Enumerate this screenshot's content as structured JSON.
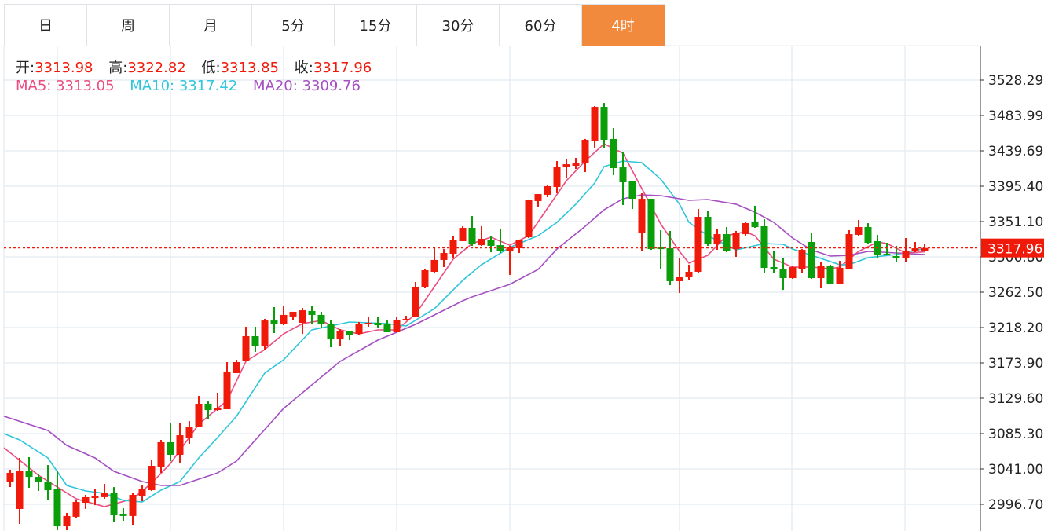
{
  "tabs": [
    {
      "label": "日",
      "active": false
    },
    {
      "label": "周",
      "active": false
    },
    {
      "label": "月",
      "active": false
    },
    {
      "label": "5分",
      "active": false
    },
    {
      "label": "15分",
      "active": false
    },
    {
      "label": "30分",
      "active": false
    },
    {
      "label": "60分",
      "active": false
    },
    {
      "label": "4时",
      "active": true
    }
  ],
  "info": {
    "open_label": "开:",
    "open": "3313.98",
    "high_label": "高:",
    "high": "3322.82",
    "low_label": "低:",
    "low": "3313.85",
    "close_label": "收:",
    "close": "3317.96",
    "ma5_label": "MA5:",
    "ma5": "3313.05",
    "ma10_label": "MA10:",
    "ma10": "3317.42",
    "ma20_label": "MA20:",
    "ma20": "3309.76"
  },
  "colors": {
    "up": "#f01a0a",
    "down": "#0a9e0a",
    "ma5": "#ec4d80",
    "ma10": "#2fc6db",
    "ma20": "#a54fc2",
    "accent": "#f28a3e"
  },
  "chart_data": {
    "type": "candlestick",
    "y_ticks": [
      "3528.29",
      "3483.99",
      "3439.69",
      "3395.40",
      "3351.10",
      "3306.80",
      "3262.50",
      "3218.20",
      "3173.90",
      "3129.60",
      "3085.30",
      "3041.00",
      "2996.70"
    ],
    "ylim": [
      2970.0,
      3528.29
    ],
    "last_price": "3317.96",
    "grid": true,
    "ohlc": [
      [
        3025.2,
        3040.0,
        3018.3,
        3036.1
      ],
      [
        2990.8,
        3054.8,
        2972.1,
        3039.0
      ],
      [
        3038.0,
        3055.8,
        3017.4,
        3031.1
      ],
      [
        3031.1,
        3035.1,
        3013.4,
        3024.3
      ],
      [
        3025.2,
        3045.9,
        3002.6,
        3014.4
      ],
      [
        3015.4,
        3038.0,
        2964.2,
        2969.1
      ],
      [
        2969.1,
        2985.9,
        2964.2,
        2982.0
      ],
      [
        2981.0,
        3002.6,
        2979.0,
        2999.6
      ],
      [
        2998.6,
        3008.5,
        2990.8,
        3005.6
      ],
      [
        3004.6,
        3015.4,
        2995.7,
        3006.5
      ],
      [
        3005.6,
        3022.3,
        3003.6,
        3010.5
      ],
      [
        3010.5,
        3018.3,
        2975.0,
        2983.9
      ],
      [
        2984.9,
        2991.8,
        2976.0,
        2982.0
      ],
      [
        2982.0,
        3010.5,
        2971.1,
        3008.5
      ],
      [
        3007.5,
        3020.3,
        3000.6,
        3015.4
      ],
      [
        3014.4,
        3051.8,
        3013.4,
        3044.9
      ],
      [
        3043.9,
        3077.4,
        3036.1,
        3074.5
      ],
      [
        3074.5,
        3099.1,
        3050.8,
        3058.7
      ],
      [
        3058.7,
        3099.1,
        3048.9,
        3083.3
      ],
      [
        3080.4,
        3101.0,
        3072.5,
        3094.1
      ],
      [
        3093.2,
        3132.5,
        3093.2,
        3122.7
      ],
      [
        3122.7,
        3126.6,
        3104.0,
        3114.8
      ],
      [
        3114.8,
        3136.5,
        3113.8,
        3116.8
      ],
      [
        3115.8,
        3174.9,
        3115.8,
        3163.1
      ],
      [
        3161.1,
        3177.8,
        3161.1,
        3174.9
      ],
      [
        3175.9,
        3219.2,
        3175.9,
        3207.4
      ],
      [
        3207.4,
        3219.2,
        3187.7,
        3195.5
      ],
      [
        3194.6,
        3229.0,
        3190.6,
        3227.0
      ],
      [
        3227.0,
        3243.8,
        3211.3,
        3223.1
      ],
      [
        3223.1,
        3245.7,
        3221.1,
        3234.0
      ],
      [
        3232.0,
        3237.9,
        3228.0,
        3237.9
      ],
      [
        3224.1,
        3242.8,
        3210.3,
        3239.8
      ],
      [
        3238.9,
        3245.7,
        3222.1,
        3234.0
      ],
      [
        3234.0,
        3237.9,
        3217.2,
        3223.1
      ],
      [
        3223.1,
        3227.0,
        3193.6,
        3203.4
      ],
      [
        3203.4,
        3216.2,
        3195.5,
        3213.3
      ],
      [
        3213.3,
        3214.3,
        3202.4,
        3209.3
      ],
      [
        3210.3,
        3225.1,
        3209.3,
        3223.1
      ],
      [
        3222.1,
        3232.0,
        3219.2,
        3224.1
      ],
      [
        3224.1,
        3232.0,
        3218.2,
        3221.1
      ],
      [
        3222.1,
        3227.0,
        3212.3,
        3212.3
      ],
      [
        3212.3,
        3231.0,
        3212.3,
        3228.0
      ],
      [
        3227.0,
        3232.9,
        3227.0,
        3229.0
      ],
      [
        3231.0,
        3275.3,
        3231.0,
        3269.4
      ],
      [
        3268.4,
        3292.0,
        3267.4,
        3290.1
      ],
      [
        3288.1,
        3317.6,
        3286.1,
        3302.9
      ],
      [
        3302.9,
        3316.6,
        3294.0,
        3311.7
      ],
      [
        3310.7,
        3332.4,
        3305.8,
        3327.5
      ],
      [
        3326.5,
        3345.2,
        3326.5,
        3343.2
      ],
      [
        3343.2,
        3358.0,
        3320.6,
        3322.5
      ],
      [
        3321.5,
        3345.2,
        3320.6,
        3329.4
      ],
      [
        3328.4,
        3333.4,
        3312.7,
        3320.6
      ],
      [
        3321.5,
        3342.2,
        3311.7,
        3313.7
      ],
      [
        3313.7,
        3320.6,
        3284.2,
        3318.6
      ],
      [
        3317.6,
        3328.4,
        3311.7,
        3327.5
      ],
      [
        3331.4,
        3378.7,
        3330.4,
        3377.7
      ],
      [
        3376.7,
        3385.5,
        3369.8,
        3385.5
      ],
      [
        3384.6,
        3397.4,
        3381.6,
        3395.4
      ],
      [
        3394.4,
        3426.9,
        3386.5,
        3420.0
      ],
      [
        3419.0,
        3429.9,
        3406.2,
        3422.9
      ],
      [
        3421.0,
        3430.8,
        3417.0,
        3423.9
      ],
      [
        3423.9,
        3454.5,
        3413.1,
        3453.5
      ],
      [
        3451.5,
        3495.8,
        3443.6,
        3494.8
      ],
      [
        3494.8,
        3499.7,
        3443.6,
        3453.5
      ],
      [
        3454.5,
        3468.2,
        3409.2,
        3418.0
      ],
      [
        3419.0,
        3438.7,
        3371.8,
        3400.3
      ],
      [
        3401.3,
        3402.3,
        3366.8,
        3379.6
      ],
      [
        3336.3,
        3386.5,
        3313.7,
        3379.6
      ],
      [
        3379.6,
        3379.6,
        3315.6,
        3316.6
      ],
      [
        3318.6,
        3340.3,
        3292.0,
        3316.6
      ],
      [
        3317.6,
        3339.3,
        3271.3,
        3276.3
      ],
      [
        3276.3,
        3305.8,
        3261.5,
        3281.2
      ],
      [
        3281.2,
        3297.0,
        3278.2,
        3288.1
      ],
      [
        3288.1,
        3366.8,
        3287.1,
        3357.0
      ],
      [
        3357.0,
        3363.9,
        3320.6,
        3322.5
      ],
      [
        3322.5,
        3342.2,
        3315.6,
        3335.3
      ],
      [
        3335.3,
        3344.2,
        3312.7,
        3313.7
      ],
      [
        3316.6,
        3339.3,
        3306.8,
        3336.3
      ],
      [
        3335.3,
        3350.1,
        3333.4,
        3349.1
      ],
      [
        3351.1,
        3370.8,
        3343.2,
        3344.2
      ],
      [
        3345.2,
        3354.0,
        3287.1,
        3293.0
      ],
      [
        3294.0,
        3314.7,
        3287.1,
        3291.0
      ],
      [
        3292.0,
        3305.8,
        3265.4,
        3280.2
      ],
      [
        3280.2,
        3295.0,
        3279.2,
        3294.0
      ],
      [
        3292.0,
        3316.6,
        3287.1,
        3315.6
      ],
      [
        3325.5,
        3336.3,
        3279.2,
        3280.2
      ],
      [
        3280.2,
        3300.9,
        3267.4,
        3296.0
      ],
      [
        3296.0,
        3297.0,
        3272.3,
        3273.3
      ],
      [
        3273.3,
        3301.9,
        3272.3,
        3293.0
      ],
      [
        3292.0,
        3340.3,
        3291.0,
        3335.3
      ],
      [
        3334.4,
        3353.1,
        3333.4,
        3344.2
      ],
      [
        3344.2,
        3349.1,
        3322.5,
        3324.5
      ],
      [
        3326.5,
        3334.4,
        3304.8,
        3308.8
      ],
      [
        3310.7,
        3324.5,
        3308.8,
        3309.7
      ],
      [
        3307.8,
        3320.6,
        3300.0,
        3305.8
      ],
      [
        3305.8,
        3330.4,
        3300.0,
        3314.7
      ],
      [
        3313.7,
        3325.5,
        3312.7,
        3317.6
      ],
      [
        3313.98,
        3322.82,
        3313.85,
        3317.96
      ]
    ],
    "ma_series": [
      {
        "name": "MA5",
        "points": [
          [
            0,
            3067.6
          ],
          [
            3,
            3033.1
          ],
          [
            7,
            3003.6
          ],
          [
            10,
            2993.7
          ],
          [
            13,
            3003.6
          ],
          [
            15,
            3023.3
          ],
          [
            17,
            3047.9
          ],
          [
            20,
            3097.1
          ],
          [
            23,
            3126.6
          ],
          [
            25,
            3175.9
          ],
          [
            27,
            3190.6
          ],
          [
            29,
            3210.3
          ],
          [
            31,
            3223.1
          ],
          [
            33,
            3227.0
          ],
          [
            35,
            3215.2
          ],
          [
            37,
            3210.3
          ],
          [
            39,
            3215.2
          ],
          [
            41,
            3215.2
          ],
          [
            43,
            3234.9
          ],
          [
            45,
            3269.4
          ],
          [
            47,
            3303.9
          ],
          [
            49,
            3323.5
          ],
          [
            51,
            3331.4
          ],
          [
            53,
            3321.5
          ],
          [
            55,
            3333.4
          ],
          [
            57,
            3367.8
          ],
          [
            59,
            3402.3
          ],
          [
            61,
            3426.9
          ],
          [
            63,
            3448.5
          ],
          [
            65,
            3436.7
          ],
          [
            67,
            3392.4
          ],
          [
            69,
            3348.1
          ],
          [
            71,
            3313.7
          ],
          [
            72,
            3299.0
          ],
          [
            74,
            3308.8
          ],
          [
            76,
            3333.4
          ],
          [
            78,
            3338.3
          ],
          [
            79,
            3333.4
          ],
          [
            81,
            3303.9
          ],
          [
            83,
            3294.0
          ],
          [
            85,
            3294.0
          ],
          [
            87,
            3292.0
          ],
          [
            88,
            3294.0
          ],
          [
            90,
            3313.7
          ],
          [
            92,
            3325.5
          ],
          [
            93,
            3323.5
          ],
          [
            95,
            3311.7
          ],
          [
            97,
            3313.05
          ]
        ]
      },
      {
        "name": "MA10",
        "points": [
          [
            0,
            3085.3
          ],
          [
            1,
            3077.4
          ],
          [
            4,
            3054.8
          ],
          [
            6,
            3020.3
          ],
          [
            8,
            3013.4
          ],
          [
            10,
            3010.5
          ],
          [
            12,
            3001.6
          ],
          [
            14,
            2999.6
          ],
          [
            16,
            3014.4
          ],
          [
            18,
            3025.2
          ],
          [
            20,
            3054.8
          ],
          [
            22,
            3080.4
          ],
          [
            24,
            3107.0
          ],
          [
            27,
            3161.1
          ],
          [
            29,
            3177.8
          ],
          [
            32,
            3215.2
          ],
          [
            36,
            3225.1
          ],
          [
            40,
            3223.1
          ],
          [
            42,
            3220.2
          ],
          [
            45,
            3241.8
          ],
          [
            48,
            3277.3
          ],
          [
            50,
            3297.0
          ],
          [
            53,
            3318.6
          ],
          [
            56,
            3333.4
          ],
          [
            58,
            3350.1
          ],
          [
            60,
            3372.8
          ],
          [
            62,
            3399.3
          ],
          [
            63,
            3420.0
          ],
          [
            65,
            3426.9
          ],
          [
            67,
            3424.9
          ],
          [
            69,
            3404.3
          ],
          [
            71,
            3372.8
          ],
          [
            72,
            3350.1
          ],
          [
            74,
            3333.4
          ],
          [
            77,
            3315.6
          ],
          [
            80,
            3323.5
          ],
          [
            82,
            3322.5
          ],
          [
            83,
            3316.6
          ],
          [
            85,
            3308.8
          ],
          [
            88,
            3297.0
          ],
          [
            89,
            3297.0
          ],
          [
            91,
            3305.8
          ],
          [
            94,
            3309.7
          ],
          [
            97,
            3317.42
          ]
        ]
      },
      {
        "name": "MA20",
        "points": [
          [
            0,
            3107.0
          ],
          [
            4,
            3089.2
          ],
          [
            6,
            3070.5
          ],
          [
            9,
            3054.8
          ],
          [
            11,
            3038.0
          ],
          [
            14,
            3025.2
          ],
          [
            16,
            3020.3
          ],
          [
            18,
            3020.3
          ],
          [
            22,
            3036.1
          ],
          [
            24,
            3050.8
          ],
          [
            29,
            3116.8
          ],
          [
            32,
            3146.3
          ],
          [
            35,
            3175.9
          ],
          [
            39,
            3202.4
          ],
          [
            43,
            3222.1
          ],
          [
            48,
            3251.7
          ],
          [
            49,
            3256.6
          ],
          [
            53,
            3272.3
          ],
          [
            56,
            3291.0
          ],
          [
            58,
            3316.6
          ],
          [
            61,
            3345.2
          ],
          [
            63,
            3365.9
          ],
          [
            65,
            3379.6
          ],
          [
            67,
            3384.6
          ],
          [
            69,
            3383.6
          ],
          [
            72,
            3377.7
          ],
          [
            74,
            3378.7
          ],
          [
            77,
            3372.8
          ],
          [
            79,
            3362.9
          ],
          [
            81,
            3350.1
          ],
          [
            83,
            3330.4
          ],
          [
            85,
            3315.6
          ],
          [
            87,
            3307.8
          ],
          [
            89,
            3308.8
          ],
          [
            91,
            3313.7
          ],
          [
            94,
            3311.7
          ],
          [
            97,
            3309.76
          ]
        ]
      }
    ]
  }
}
